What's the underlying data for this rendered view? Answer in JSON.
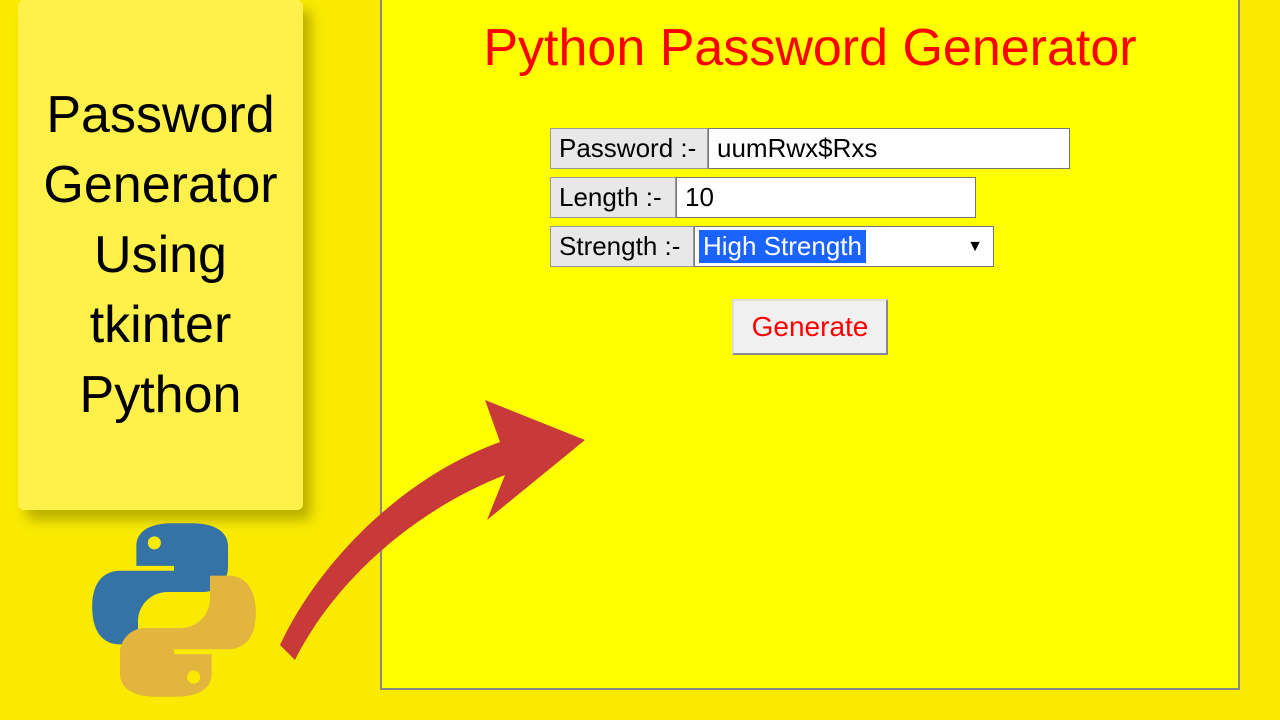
{
  "left_card": {
    "title": "Password Generator Using tkinter Python"
  },
  "app": {
    "title": "Python Password Generator",
    "password_label": "Password :-",
    "password_value": "uumRwx$Rxs",
    "length_label": "Length :-",
    "length_value": "10",
    "strength_label": "Strength :-",
    "strength_value": "High Strength",
    "generate_label": "Generate"
  },
  "icons": {
    "python_logo": "python-logo",
    "arrow": "arrow-up-right"
  },
  "colors": {
    "bg": "#f9ea00",
    "card": "#fff14a",
    "window": "#ffff00",
    "accent_red": "#ff0000",
    "select_blue": "#1a63ff"
  }
}
